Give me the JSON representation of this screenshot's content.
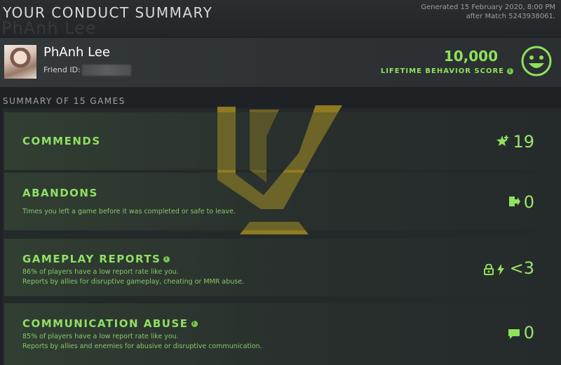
{
  "header": {
    "title": "YOUR CONDUCT SUMMARY",
    "watermark_name": "PhAnh Lee",
    "generated_line1": "Generated 15 February 2020, 8:00 PM",
    "generated_line2": "after Match 5243938061."
  },
  "profile": {
    "name": "PhAnh Lee",
    "friend_id_label": "Friend ID:",
    "behavior_score": "10,000",
    "behavior_label": "LIFETIME BEHAVIOR SCORE",
    "info_glyph": "i"
  },
  "summary": {
    "heading": "SUMMARY OF 15 GAMES",
    "cards": [
      {
        "title": "COMMENDS",
        "value": "19",
        "icon": "star-plus-icon",
        "lines": []
      },
      {
        "title": "ABANDONS",
        "value": "0",
        "icon": "exit-door-icon",
        "lines": [
          "Times you left a game before it was completed or safe to leave."
        ]
      },
      {
        "title": "GAMEPLAY REPORTS",
        "value": "<3",
        "icon": "lock-lightning-icon",
        "lines": [
          "86% of players have a low report rate like you.",
          "Reports by allies for disruptive gameplay, cheating or MMR abuse."
        ]
      },
      {
        "title": "COMMUNICATION ABUSE",
        "value": "0",
        "icon": "chat-bubble-icon",
        "lines": [
          "85% of players have a low report rate like you.",
          "Reports by allies and enemies for abusive or disruptive communication."
        ]
      }
    ]
  },
  "colors": {
    "accent_green": "#8ee25c",
    "background": "#1f2224",
    "logo_gold": "#b89a1e"
  }
}
